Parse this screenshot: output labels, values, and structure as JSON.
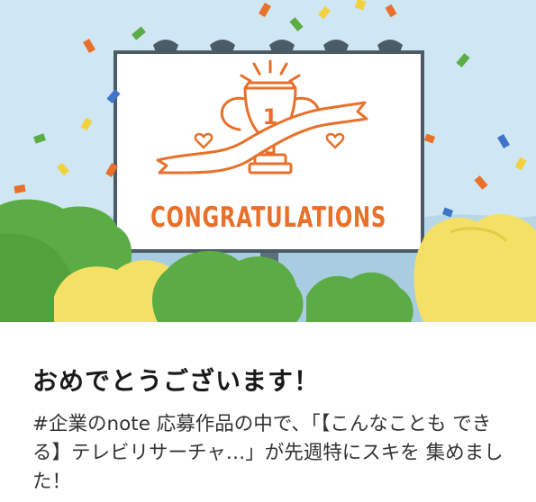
{
  "illustration": {
    "board_text": "CONGRATULATIONS",
    "trophy_number": "1",
    "colors": {
      "sky": "#cfe6f3",
      "far_hills": "#b7d6e6",
      "board": "#ffffff",
      "board_border": "#4c5c67",
      "post": "#5f6f7a",
      "accent": "#e8702a",
      "tree_green": "#5bac45",
      "tree_dark": "#3f8f2f",
      "tree_yellow": "#f4e064",
      "confetti": [
        "#e8702a",
        "#f2d23c",
        "#5bac45",
        "#3f74c9"
      ]
    },
    "icons": [
      "trophy-icon",
      "ribbon-icon",
      "heart-icon",
      "confetti-icon",
      "tree-icon"
    ]
  },
  "notification": {
    "title": "おめでとうございます！",
    "message": "#企業のnote 応募作品の中で、「【こんなことも できる】テレビリサーチャ…」が先週特にスキを 集めました！"
  }
}
